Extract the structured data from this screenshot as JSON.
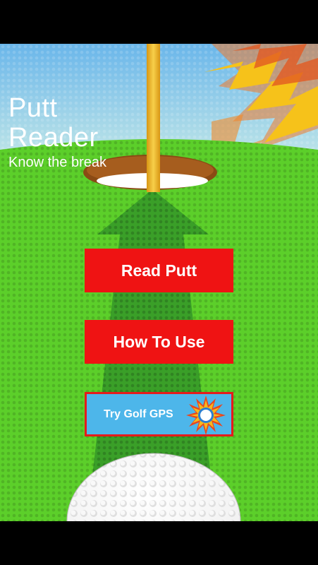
{
  "app": {
    "title_line1": "Putt",
    "title_line2": "Reader",
    "subtitle": "Know the break"
  },
  "buttons": {
    "read_putt": "Read Putt",
    "how_to_use": "How To Use",
    "try_gps": "Try Golf GPS"
  },
  "colors": {
    "grass": "#5ccf2a",
    "sky": "#5aa8e4",
    "button_red": "#ef1313",
    "gps_blue": "#4db6ea",
    "flagpole": "#f2b51e"
  },
  "icons": {
    "flag": "flagpole-icon",
    "hole": "cup-hole",
    "arrow": "putt-direction-arrow",
    "ball": "golf-ball",
    "starburst": "starburst-decoration",
    "gps": "gps-starburst-icon"
  }
}
